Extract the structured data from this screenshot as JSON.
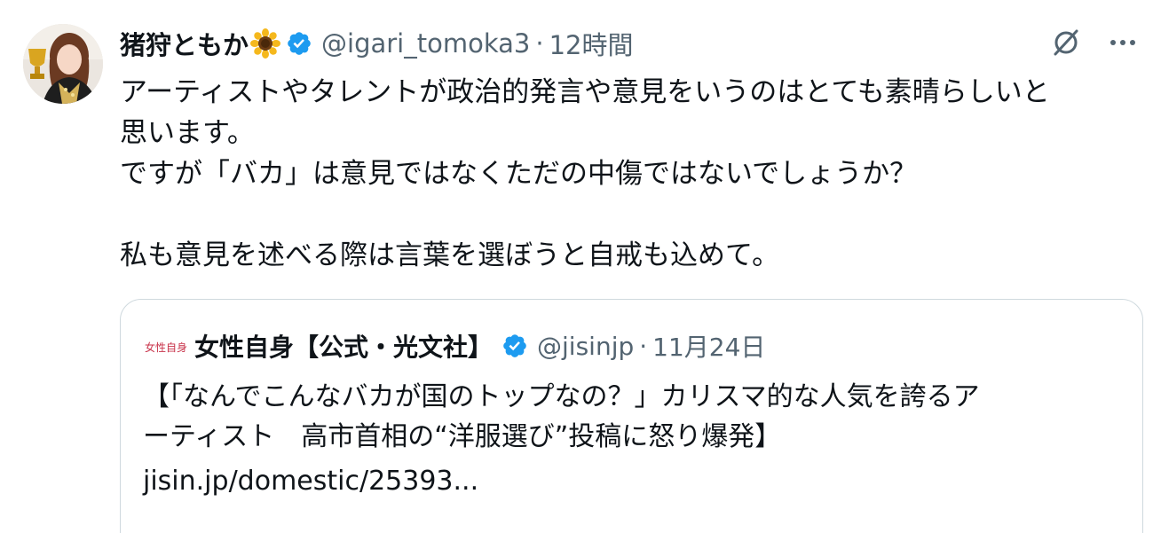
{
  "tweet": {
    "author": {
      "display_name": "猪狩ともか",
      "name_emoji": "sunflower-icon",
      "verified": true,
      "handle": "@igari_tomoka3",
      "separator": "·",
      "time": "12時間"
    },
    "text": "アーティストやタレントが政治的発言や意見をいうのはとても素晴らしいと\n思います。\nですが「バカ」は意見ではなくただの中傷ではないでしょうか？\n\n私も意見を述べる際は言葉を選ぼうと自戒も込めて。",
    "actions": {
      "grok_icon": "grok-icon",
      "more_icon": "more-icon"
    }
  },
  "quoted_tweet": {
    "author": {
      "display_name": "女性自身【公式・光文社】",
      "logo_text": "女性自身",
      "verified": true,
      "handle": "@jisinjp",
      "separator": "·",
      "time": "11月24日"
    },
    "text": "【「なんでこんなバカが国のトップなの？」カリスマ的な人気を誇るア\nーティスト　高市首相の“洋服選び”投稿に怒り爆発】",
    "link": "jisin.jp/domestic/25393..."
  },
  "colors": {
    "text_primary": "#0f1419",
    "text_secondary": "#536471",
    "verified_blue": "#1d9bf0",
    "border": "#cfd9de",
    "logo_red": "#c8334a"
  }
}
